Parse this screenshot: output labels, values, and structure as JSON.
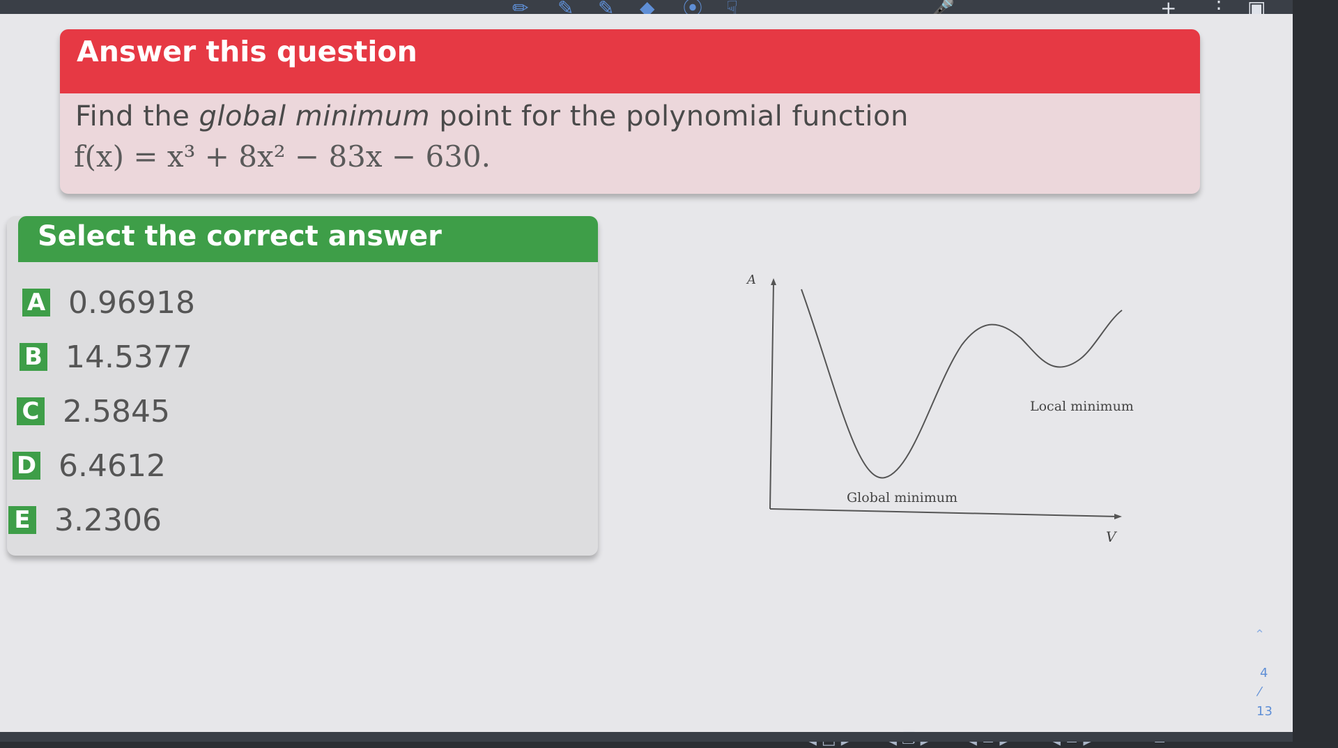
{
  "question": {
    "header": "Answer this question",
    "text_before": "Find the ",
    "text_emphasis": "global minimum",
    "text_after": " point for the polynomial function",
    "formula": "f(x) = x³ + 8x² − 83x − 630."
  },
  "answers": {
    "header": "Select the correct answer",
    "options": [
      {
        "letter": "A",
        "value": "0.96918"
      },
      {
        "letter": "B",
        "value": "14.5377"
      },
      {
        "letter": "C",
        "value": "2.5845"
      },
      {
        "letter": "D",
        "value": "6.4612"
      },
      {
        "letter": "E",
        "value": "3.2306"
      }
    ]
  },
  "graph": {
    "y_label": "A",
    "x_label": "V",
    "local_label": "Local minimum",
    "global_label": "Global minimum"
  },
  "side": {
    "page_current": "4",
    "page_total": "13"
  },
  "icons": {
    "toolbar": [
      "pen-icon",
      "highlighter-icon",
      "eraser-icon",
      "lasso-icon",
      "hand-icon",
      "mic-icon",
      "add-icon",
      "more-icon",
      "page-icon"
    ],
    "accent": "#5f8fd6",
    "question_color": "#e63944",
    "answer_color": "#3e9e48"
  }
}
